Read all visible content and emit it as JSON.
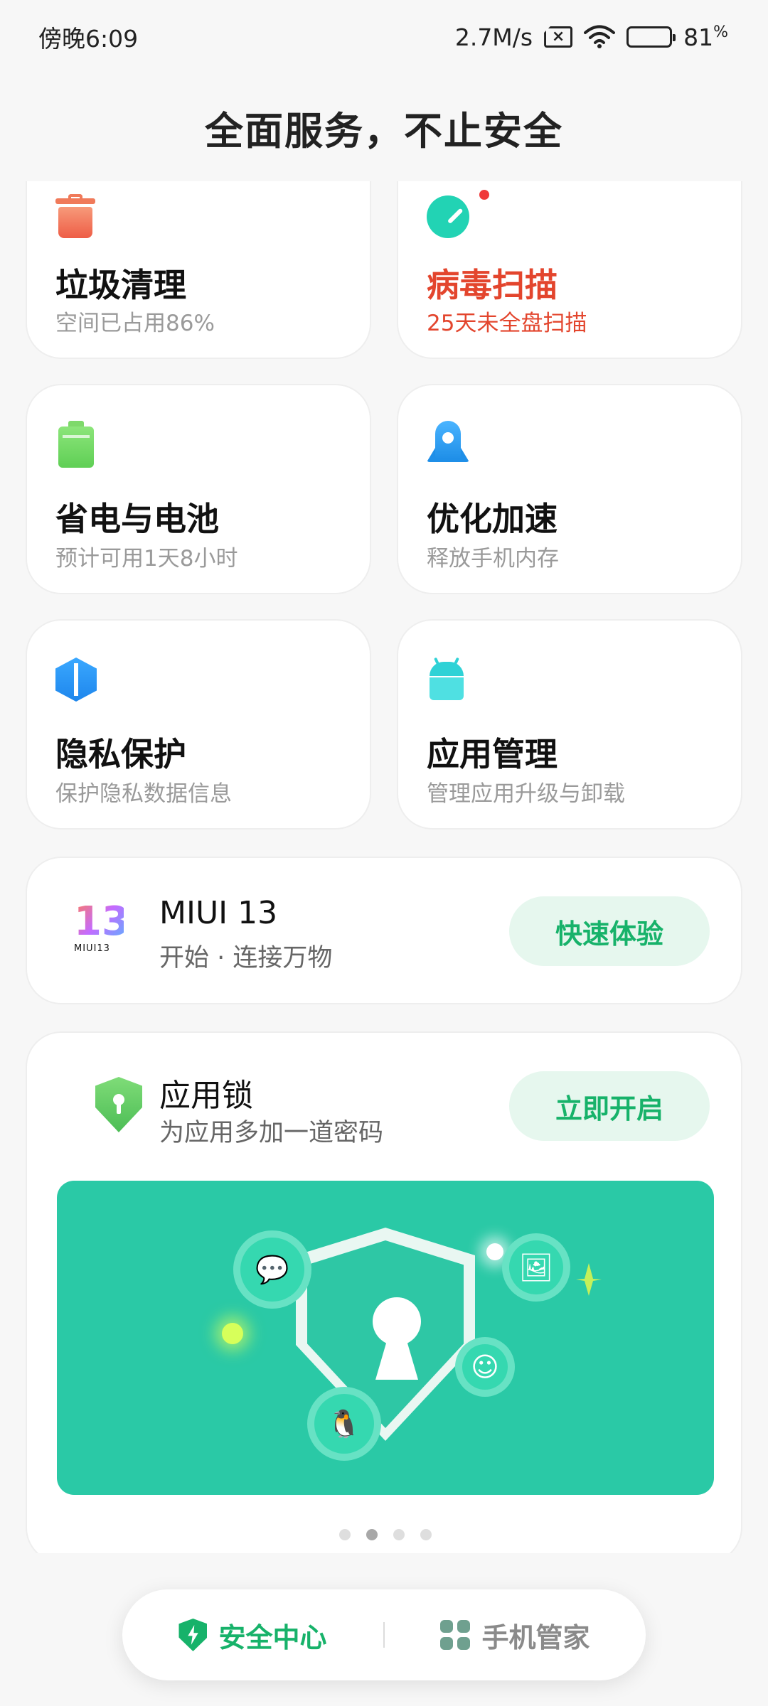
{
  "status_bar": {
    "time": "傍晚6:09",
    "net_speed": "2.7M/s",
    "battery": "81",
    "battery_unit": "%",
    "icons": [
      "sim-no-signal-icon",
      "wifi-icon",
      "battery-icon"
    ],
    "battery_level_percent": 81
  },
  "header": {
    "title": "全面服务，不止安全"
  },
  "tiles": [
    {
      "title": "垃圾清理",
      "subtitle": "空间已占用86%",
      "icon": "trash-icon"
    },
    {
      "title": "病毒扫描",
      "subtitle": "25天未全盘扫描",
      "icon": "virus-scan-icon",
      "alert": true
    },
    {
      "title": "省电与电池",
      "subtitle": "预计可用1天8小时",
      "icon": "battery-icon"
    },
    {
      "title": "优化加速",
      "subtitle": "释放手机内存",
      "icon": "rocket-icon"
    },
    {
      "title": "隐私保护",
      "subtitle": "保护隐私数据信息",
      "icon": "privacy-icon"
    },
    {
      "title": "应用管理",
      "subtitle": "管理应用升级与卸载",
      "icon": "android-icon"
    }
  ],
  "miui_card": {
    "logo_number": "13",
    "logo_text": "MIUI13",
    "title": "MIUI 13",
    "subtitle": "开始 · 连接万物",
    "button": "快速体验"
  },
  "app_lock_card": {
    "title": "应用锁",
    "subtitle": "为应用多加一道密码",
    "button": "立即开启",
    "carousel_pages": 4,
    "carousel_active_index": 1
  },
  "bottom_nav": {
    "items": [
      {
        "label": "安全中心",
        "icon": "shield-bolt-icon",
        "active": true
      },
      {
        "label": "手机管家",
        "icon": "grid-apps-icon",
        "active": false
      }
    ]
  },
  "colors": {
    "accent_green": "#17b26a",
    "alert_red": "#e3452d",
    "banner_teal": "#2ac9a6"
  }
}
